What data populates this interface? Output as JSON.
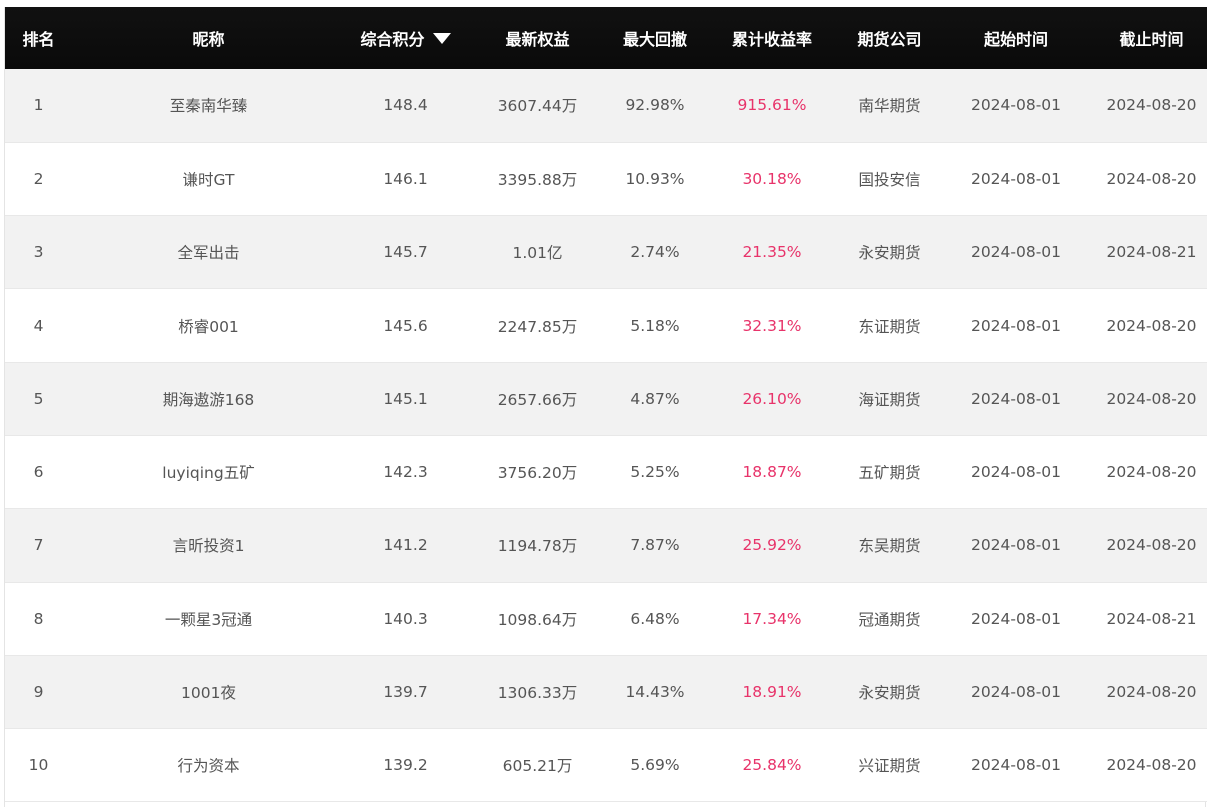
{
  "table": {
    "headers": {
      "rank": "排名",
      "nickname": "昵称",
      "score": "综合积分",
      "equity": "最新权益",
      "drawdown": "最大回撤",
      "return": "累计收益率",
      "company": "期货公司",
      "start": "起始时间",
      "end": "截止时间"
    },
    "sort_indicator": "caret-down-icon",
    "return_color": "#e8336a",
    "rows": [
      {
        "rank": "1",
        "nickname": "至秦南华臻",
        "score": "148.4",
        "equity": "3607.44万",
        "drawdown": "92.98%",
        "return": "915.61%",
        "company": "南华期货",
        "start": "2024-08-01",
        "end": "2024-08-20"
      },
      {
        "rank": "2",
        "nickname": "谦时GT",
        "score": "146.1",
        "equity": "3395.88万",
        "drawdown": "10.93%",
        "return": "30.18%",
        "company": "国投安信",
        "start": "2024-08-01",
        "end": "2024-08-20"
      },
      {
        "rank": "3",
        "nickname": "全军出击",
        "score": "145.7",
        "equity": "1.01亿",
        "drawdown": "2.74%",
        "return": "21.35%",
        "company": "永安期货",
        "start": "2024-08-01",
        "end": "2024-08-21"
      },
      {
        "rank": "4",
        "nickname": "桥睿001",
        "score": "145.6",
        "equity": "2247.85万",
        "drawdown": "5.18%",
        "return": "32.31%",
        "company": "东证期货",
        "start": "2024-08-01",
        "end": "2024-08-20"
      },
      {
        "rank": "5",
        "nickname": "期海遨游168",
        "score": "145.1",
        "equity": "2657.66万",
        "drawdown": "4.87%",
        "return": "26.10%",
        "company": "海证期货",
        "start": "2024-08-01",
        "end": "2024-08-20"
      },
      {
        "rank": "6",
        "nickname": "luyiqing五矿",
        "score": "142.3",
        "equity": "3756.20万",
        "drawdown": "5.25%",
        "return": "18.87%",
        "company": "五矿期货",
        "start": "2024-08-01",
        "end": "2024-08-20"
      },
      {
        "rank": "7",
        "nickname": "言昕投资1",
        "score": "141.2",
        "equity": "1194.78万",
        "drawdown": "7.87%",
        "return": "25.92%",
        "company": "东吴期货",
        "start": "2024-08-01",
        "end": "2024-08-20"
      },
      {
        "rank": "8",
        "nickname": "一颗星3冠通",
        "score": "140.3",
        "equity": "1098.64万",
        "drawdown": "6.48%",
        "return": "17.34%",
        "company": "冠通期货",
        "start": "2024-08-01",
        "end": "2024-08-21"
      },
      {
        "rank": "9",
        "nickname": "1001夜",
        "score": "139.7",
        "equity": "1306.33万",
        "drawdown": "14.43%",
        "return": "18.91%",
        "company": "永安期货",
        "start": "2024-08-01",
        "end": "2024-08-20"
      },
      {
        "rank": "10",
        "nickname": "行为资本",
        "score": "139.2",
        "equity": "605.21万",
        "drawdown": "5.69%",
        "return": "25.84%",
        "company": "兴证期货",
        "start": "2024-08-01",
        "end": "2024-08-20"
      }
    ]
  }
}
